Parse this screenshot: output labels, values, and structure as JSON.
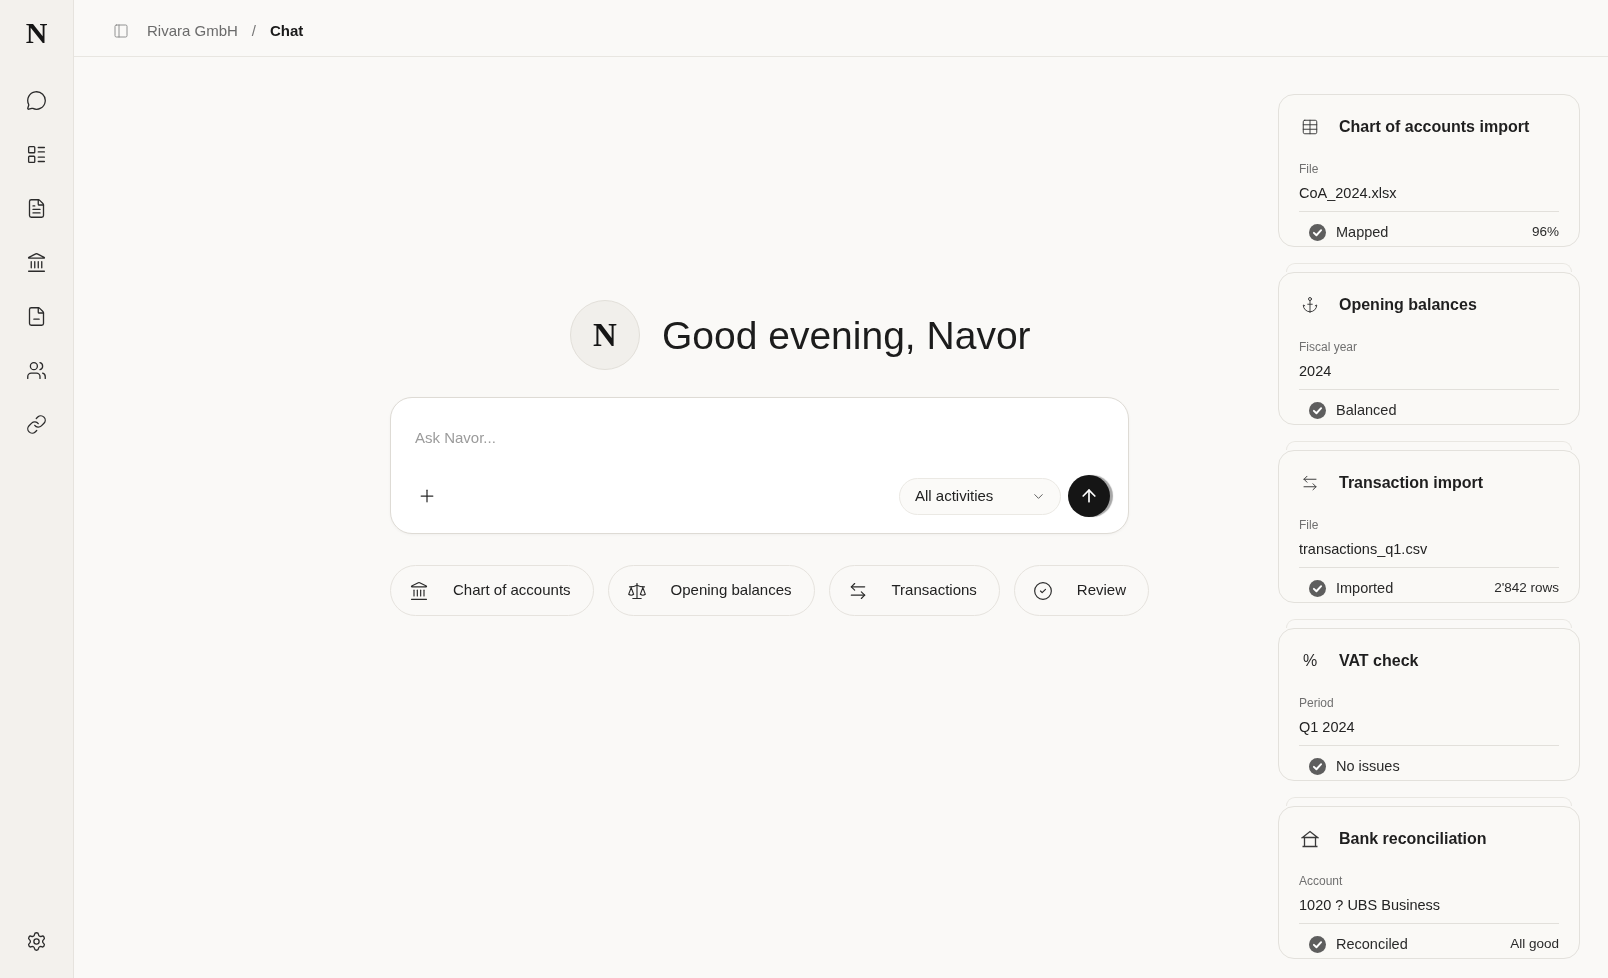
{
  "sidebar": {
    "logo": "N"
  },
  "breadcrumb": {
    "items": [
      {
        "label": "Rivara GmbH",
        "current": false
      },
      {
        "label": "Chat",
        "current": true
      }
    ],
    "separator": "/"
  },
  "greeting": {
    "avatar_letter": "N",
    "text": "Good evening, Navor"
  },
  "composer": {
    "placeholder": "Ask Navor...",
    "scope": "All activities"
  },
  "quick_actions": [
    {
      "label": "Chart of accounts"
    },
    {
      "label": "Opening balances"
    },
    {
      "label": "Transactions"
    },
    {
      "label": "Review"
    }
  ],
  "task_cards": [
    {
      "title": "Chart of accounts import",
      "field_label": "File",
      "field_value": "CoA_2024.xlsx",
      "status": "Mapped",
      "status_value": "96%"
    },
    {
      "title": "Opening balances",
      "field_label": "Fiscal year",
      "field_value": "2024",
      "status": "Balanced"
    },
    {
      "title": "Transaction import",
      "field_label": "File",
      "field_value": "transactions_q1.csv",
      "status": "Imported",
      "status_value": "2'842 rows"
    },
    {
      "icon_text": "%",
      "title": "VAT check",
      "field_label": "Period",
      "field_value": "Q1 2024",
      "status": "No issues"
    },
    {
      "title": "Bank reconciliation",
      "field_label": "Account",
      "field_value": "1020 ? UBS Business",
      "status": "Reconciled",
      "status_value": "All good"
    }
  ]
}
